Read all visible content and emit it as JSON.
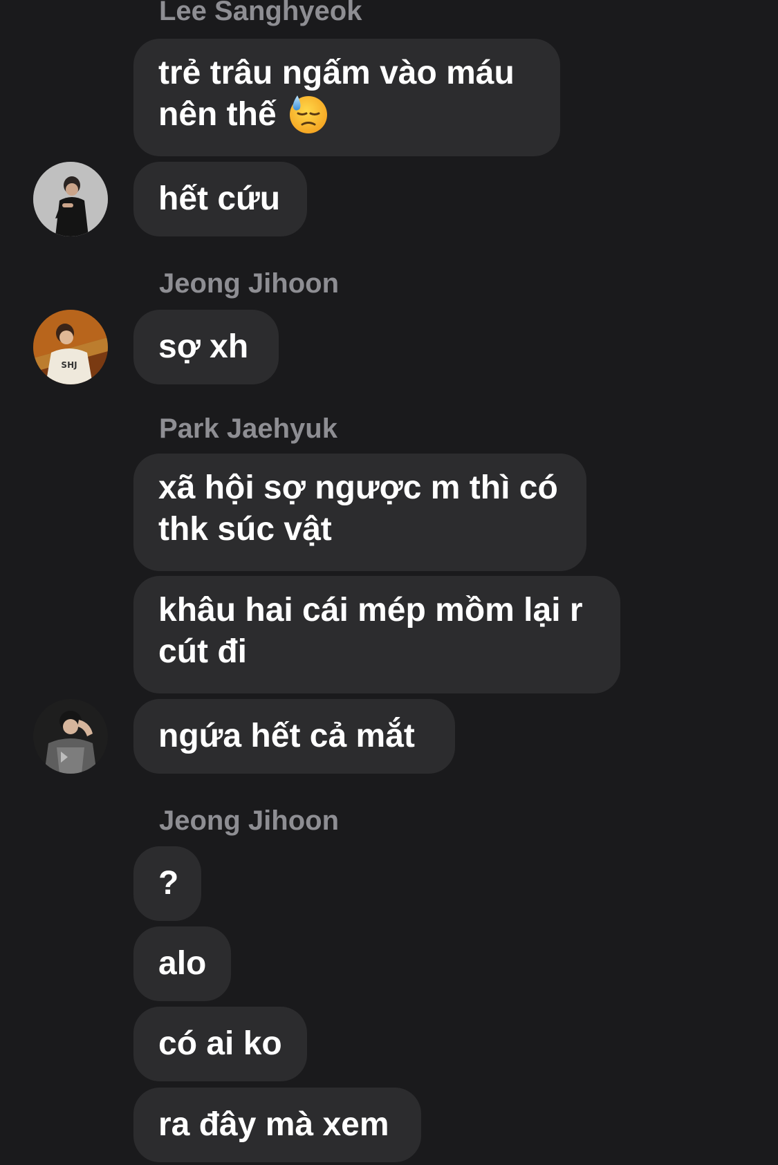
{
  "chat": {
    "messages": [
      {
        "sender": "Lee Sanghyeok",
        "lines": [
          "trẻ trâu ngấm vào máu",
          "nên thế"
        ],
        "emoji": "downcast-face-with-sweat"
      },
      {
        "text": "hết cứu"
      },
      {
        "sender": "Jeong Jihoon",
        "text": "sợ xh"
      },
      {
        "sender": "Park Jaehyuk",
        "lines": [
          "xã hội sợ ngược m thì có",
          "thk súc vật"
        ]
      },
      {
        "lines": [
          "khâu hai cái mép mồm lại r",
          "cút đi"
        ]
      },
      {
        "text": "ngứa hết cả mắt"
      },
      {
        "sender": "Jeong Jihoon",
        "text": "?"
      },
      {
        "text": "alo"
      },
      {
        "text": "có ai ko"
      },
      {
        "text": "ra đây mà xem"
      }
    ]
  },
  "colors": {
    "background": "#1a1a1c",
    "bubble": "#2c2c2e",
    "sender_name": "#8e8e93",
    "message_text": "#ffffff"
  },
  "avatars": [
    {
      "name": "avatar-lee-sanghyeok",
      "icon": "person-photo-icon"
    },
    {
      "name": "avatar-jeong-jihoon",
      "icon": "person-photo-icon"
    },
    {
      "name": "avatar-park-jaehyuk",
      "icon": "person-photo-icon"
    }
  ]
}
